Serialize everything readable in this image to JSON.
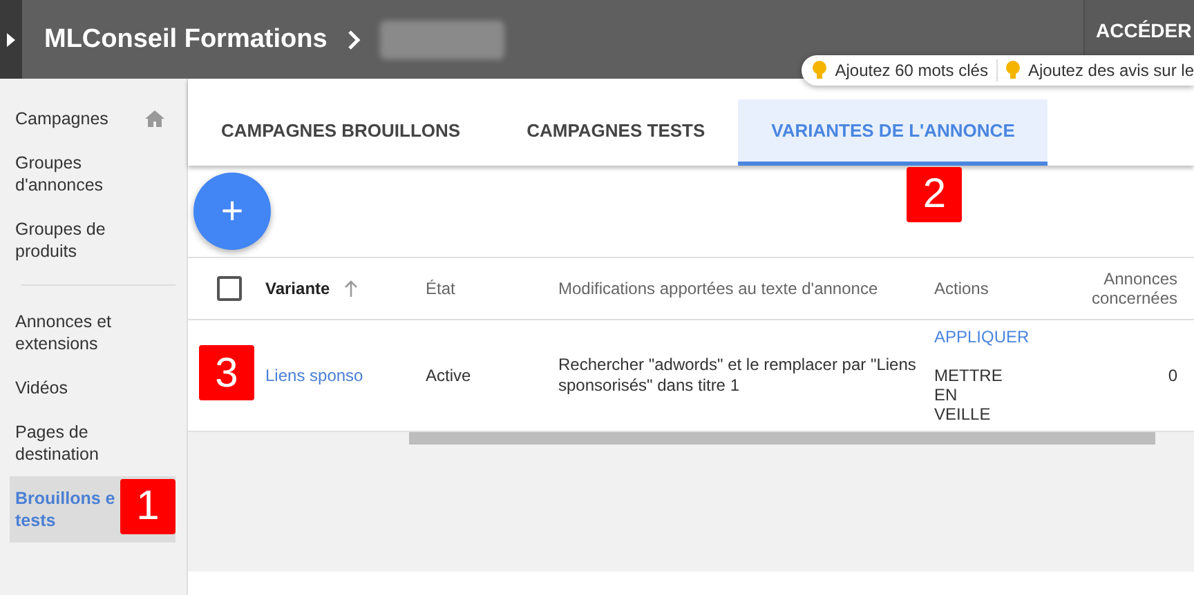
{
  "header": {
    "title": "MLConseil Formations",
    "action": "ACCÉDER"
  },
  "tips": [
    "Ajoutez 60 mots clés",
    "Ajoutez des avis sur le"
  ],
  "sidebar": {
    "items": [
      {
        "label": "Campagnes",
        "kind": "home",
        "selected": false
      },
      {
        "label": "Groupes d'annonces",
        "kind": "plain",
        "selected": false
      },
      {
        "label": "Groupes de produits",
        "kind": "plain",
        "selected": false
      },
      {
        "label": "Annonces et extensions",
        "kind": "plain",
        "selected": false,
        "divider_before": true
      },
      {
        "label": "Vidéos",
        "kind": "plain",
        "selected": false
      },
      {
        "label": "Pages de destination",
        "kind": "plain",
        "selected": false
      },
      {
        "label": "Brouillons e tests",
        "kind": "plain",
        "selected": true,
        "annotation": "1"
      }
    ]
  },
  "tabs": [
    {
      "label": "CAMPAGNES BROUILLONS",
      "selected": false
    },
    {
      "label": "CAMPAGNES TESTS",
      "selected": false
    },
    {
      "label": "VARIANTES DE L'ANNONCE",
      "selected": true,
      "annotation": "2"
    }
  ],
  "add_button": "+",
  "table": {
    "select_all_checked": false,
    "columns": [
      "Variante",
      "État",
      "Modifications apportées au texte d'annonce",
      "Actions",
      "Annonces concernées"
    ],
    "rows": [
      {
        "annotation": "3",
        "variant": "Liens sponso",
        "state": "Active",
        "modification": "Rechercher \"adwords\" et le remplacer par \"Liens sponsorisés\" dans titre 1",
        "actions": [
          "APPLIQUER",
          "METTRE EN VEILLE"
        ],
        "count": "0"
      }
    ]
  }
}
